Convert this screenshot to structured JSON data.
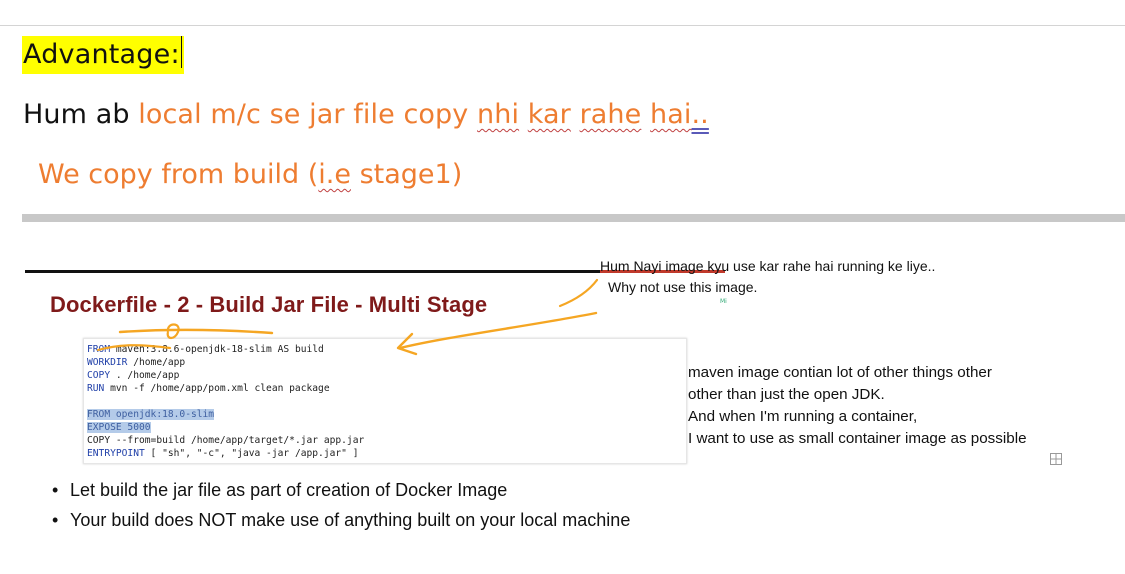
{
  "heading": {
    "text": "Advantage:"
  },
  "line1": {
    "part1": "Hum ab ",
    "part2": "local m/c se jar file copy ",
    "part3": "nhi",
    "part4": " ",
    "part5": "kar",
    "part6": " ",
    "part7": "rahe",
    "part8": " ",
    "part9": "hai",
    "part10": ".."
  },
  "line2": {
    "part1": "We copy from build (",
    "part2": "i.e",
    "part3": " stage1)"
  },
  "slide": {
    "title": "Dockerfile - 2 - Build Jar File - Multi Stage",
    "code": {
      "lines": [
        {
          "kw": "FROM",
          "rest": " maven:3.8.6-openjdk-18-slim AS build"
        },
        {
          "kw": "WORKDIR",
          "rest": " /home/app"
        },
        {
          "kw": "COPY",
          "rest": " . /home/app"
        },
        {
          "kw": "RUN",
          "rest": " mvn -f /home/app/pom.xml clean package"
        },
        {
          "kw": "FROM",
          "rest": " openjdk:18.0-slim"
        },
        {
          "kw": "EXPOSE",
          "rest": " 5000"
        },
        {
          "kw": "COPY",
          "rest": " --from=build /home/app/target/*.jar app.jar"
        },
        {
          "kw": "ENTRYPOINT",
          "rest": " [ \"sh\", \"-c\", \"java -jar /app.jar\" ]"
        }
      ]
    },
    "bullets": [
      "Let build the jar file as part of creation of Docker Image",
      "Your build does NOT make use of anything built on your local machine"
    ]
  },
  "note_top": {
    "line1": "Hum Nayi image kyu use kar rahe hai running ke liye..",
    "line2": "Why not use this image."
  },
  "tiny_mark": "Mi",
  "right_notes": [
    "maven image contian lot of other things  other",
    "other than just the open JDK.",
    "And when I'm running a container,",
    "I want to use as small container image as possible"
  ],
  "icons": {
    "expand": "expand-grid-icon"
  },
  "colors": {
    "highlight": "#ffff00",
    "orange_text": "#ee7d31",
    "title_red": "#7f1a1a",
    "ink": "#f5a623",
    "code_keyword": "#1f3fa8",
    "selection": "#b4cbe9"
  }
}
